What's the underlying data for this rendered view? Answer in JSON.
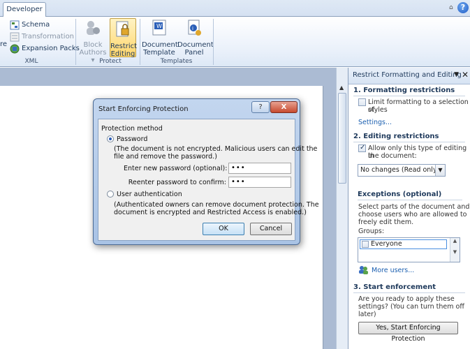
{
  "ribbon": {
    "tab": "Developer",
    "xml_group": {
      "truncated_label": "re",
      "schema": "Schema",
      "transformation": "Transformation",
      "expansion_packs": "Expansion Packs",
      "label": "XML"
    },
    "protect_group": {
      "block_authors": [
        "Block",
        "Authors"
      ],
      "restrict_editing": [
        "Restrict",
        "Editing"
      ],
      "label": "Protect"
    },
    "templates_group": {
      "document_template": [
        "Document",
        "Template"
      ],
      "document_panel": [
        "Document",
        "Panel"
      ],
      "label": "Templates"
    },
    "colors": {
      "active_button": "#ffd66b",
      "ribbon_bg": "#e9f0fa"
    }
  },
  "dialog": {
    "title": "Start Enforcing Protection",
    "help_label": "?",
    "close_label": "X",
    "section_label": "Protection method",
    "password_option": "Password",
    "password_note": [
      "(The document is not encrypted. Malicious users can edit the",
      "file and remove the password.)"
    ],
    "new_password_label": "Enter new password (optional):",
    "new_password_value": "•••",
    "confirm_password_label": "Reenter password to confirm:",
    "confirm_password_value": "•••",
    "user_auth_option": "User authentication",
    "user_auth_note": [
      "(Authenticated owners can remove document protection. The",
      "document is encrypted and Restricted Access is enabled.)"
    ],
    "ok_label": "OK",
    "cancel_label": "Cancel"
  },
  "taskpane": {
    "title": "Restrict Formatting and Editing",
    "section1_title": "1. Formatting restrictions",
    "limit_formatting": [
      "Limit formatting to a selection of",
      "styles"
    ],
    "settings_link": "Settings...",
    "section2_title": "2. Editing restrictions",
    "allow_editing": [
      "Allow only this type of editing in",
      "the document:"
    ],
    "editing_type": "No changes (Read only)",
    "exceptions_title": "Exceptions (optional)",
    "exceptions_desc": [
      "Select parts of the document and",
      "choose users who are allowed to",
      "freely edit them."
    ],
    "groups_label": "Groups:",
    "group_everyone": "Everyone",
    "more_users": "More users...",
    "section3_title": "3. Start enforcement",
    "enforcement_desc": [
      "Are you ready to apply these",
      "settings? (You can turn them off",
      "later)"
    ],
    "start_button": "Yes, Start Enforcing Protection"
  }
}
